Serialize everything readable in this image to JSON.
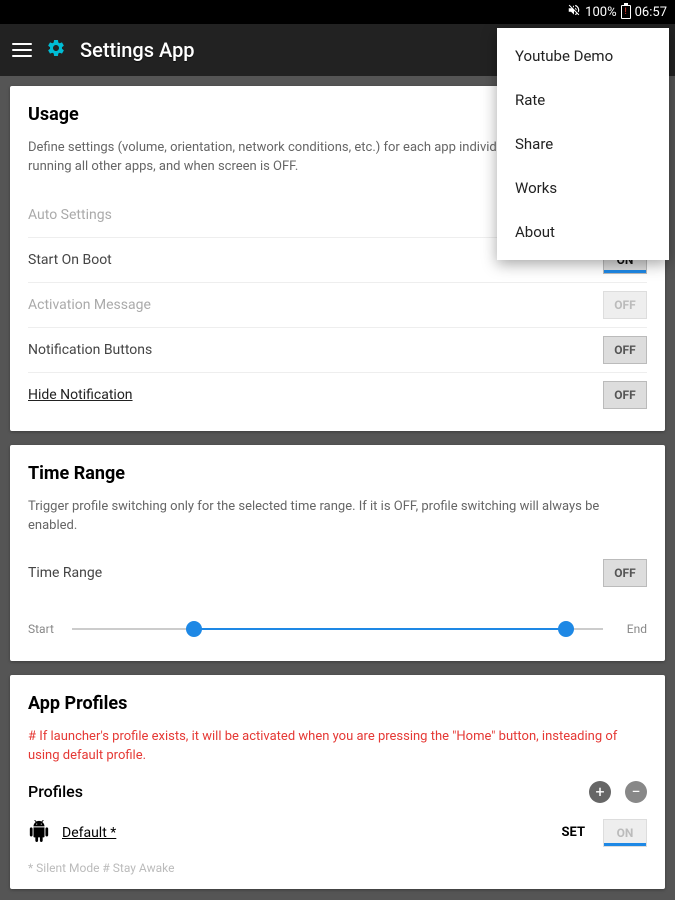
{
  "status": {
    "battery": "100%",
    "time": "06:57",
    "batt_glyph": "!"
  },
  "toolbar": {
    "title": "Settings App"
  },
  "menu": {
    "items": [
      "Youtube Demo",
      "Rate",
      "Share",
      "Works",
      "About"
    ]
  },
  "usage": {
    "title": "Usage",
    "desc": "Define settings (volume, orientation, network conditions, etc.) for each app individually, when you are running all other apps, and when screen is OFF.",
    "rows": {
      "auto": "Auto Settings",
      "boot": "Start On Boot",
      "activation": "Activation Message",
      "notif_btns": "Notification Buttons",
      "hide_notif": "Hide Notification"
    },
    "toggles": {
      "boot": "ON",
      "activation": "OFF",
      "notif_btns": "OFF",
      "hide_notif": "OFF"
    }
  },
  "timerange": {
    "title": "Time Range",
    "desc": "Trigger profile switching only for the selected time range. If it is OFF, profile switching will always be enabled.",
    "label": "Time Range",
    "toggle": "OFF",
    "start": "Start",
    "end": "End"
  },
  "profiles": {
    "title": "App Profiles",
    "note": "# If launcher's profile exists, it will be activated when you are pressing the \"Home\" button, insteading of using default profile.",
    "header": "Profiles",
    "default_name": "Default *",
    "set": "SET",
    "on": "ON",
    "cutoff": "* Silent Mode     # Stay Awake"
  }
}
